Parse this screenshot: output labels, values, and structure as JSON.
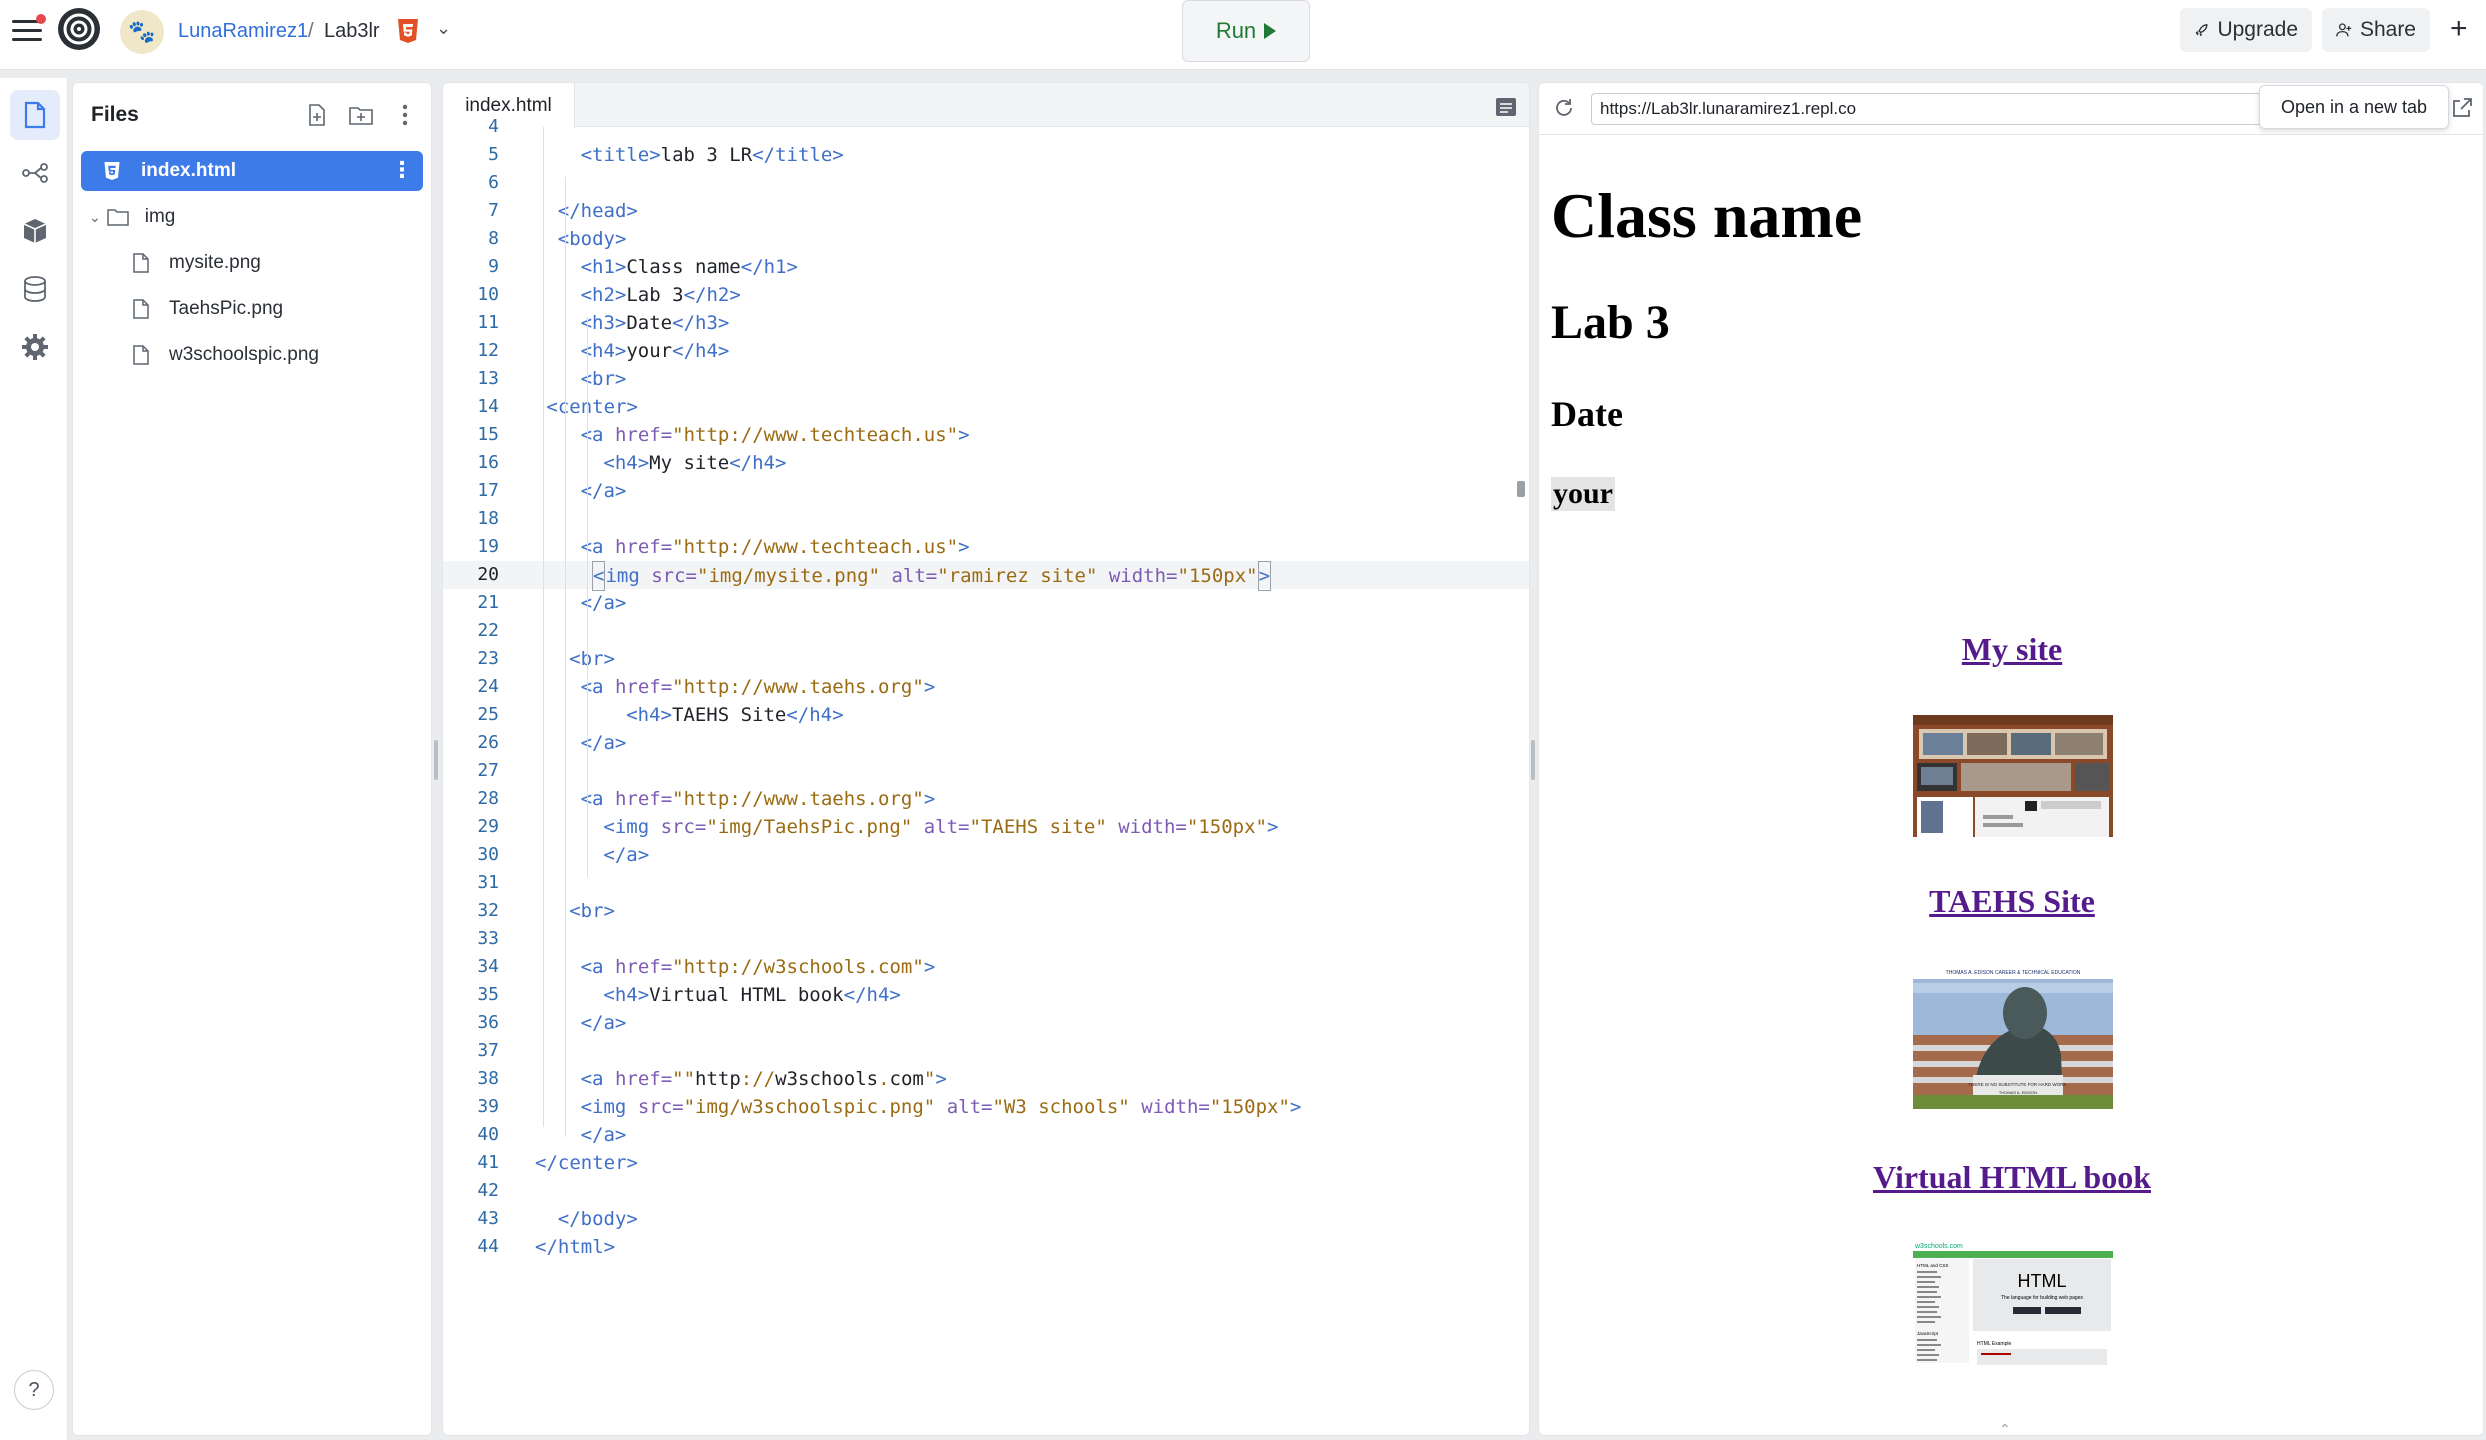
{
  "topbar": {
    "username": "LunaRamirez1",
    "separator": "/",
    "repl_name": "Lab3lr",
    "run_label": "Run",
    "upgrade_label": "Upgrade",
    "share_label": "Share",
    "new_tab_symbol": "+"
  },
  "rail": {
    "items": [
      "files-icon",
      "git-icon",
      "packages-icon",
      "database-icon",
      "settings-icon"
    ],
    "help_label": "?"
  },
  "files": {
    "title": "Files",
    "items": [
      {
        "name": "index.html",
        "type": "html",
        "selected": true
      },
      {
        "name": "img",
        "type": "folder"
      },
      {
        "name": "mysite.png",
        "type": "file"
      },
      {
        "name": "TaehsPic.png",
        "type": "file"
      },
      {
        "name": "w3schoolspic.png",
        "type": "file"
      }
    ]
  },
  "editor": {
    "tab_label": "index.html",
    "active_line": 20,
    "lines": [
      {
        "n": 4,
        "indent": 2,
        "html": ""
      },
      {
        "n": 5,
        "indent": 2,
        "html": "<span class='tg'>&lt;title&gt;</span><span class='tx'>lab 3 LR</span><span class='tg'>&lt;/title&gt;</span>"
      },
      {
        "n": 6,
        "indent": 0,
        "html": ""
      },
      {
        "n": 7,
        "indent": 1,
        "html": "<span class='tg'>&lt;/head&gt;</span>"
      },
      {
        "n": 8,
        "indent": 1,
        "html": "<span class='tg'>&lt;body&gt;</span>"
      },
      {
        "n": 9,
        "indent": 2,
        "html": "<span class='tg'>&lt;h1&gt;</span><span class='tx'>Class name</span><span class='tg'>&lt;/h1&gt;</span>"
      },
      {
        "n": 10,
        "indent": 2,
        "html": "<span class='tg'>&lt;h2&gt;</span><span class='tx'>Lab 3</span><span class='tg'>&lt;/h2&gt;</span>"
      },
      {
        "n": 11,
        "indent": 2,
        "html": "<span class='tg'>&lt;h3&gt;</span><span class='tx'>Date</span><span class='tg'>&lt;/h3&gt;</span>"
      },
      {
        "n": 12,
        "indent": 2,
        "html": "<span class='tg'>&lt;h4&gt;</span><span class='tx'>your</span><span class='tg'>&lt;/h4&gt;</span>"
      },
      {
        "n": 13,
        "indent": 2,
        "html": "<span class='tg'>&lt;br&gt;</span>"
      },
      {
        "n": 14,
        "indent": 0.5,
        "html": "<span class='tg'>&lt;center&gt;</span>"
      },
      {
        "n": 15,
        "indent": 2,
        "html": "<span class='tg'>&lt;a</span> <span class='at'>href=</span><span class='st'>\"http://www.techteach.us\"</span><span class='tg'>&gt;</span>"
      },
      {
        "n": 16,
        "indent": 3,
        "html": "<span class='tg'>&lt;h4&gt;</span><span class='tx'>My site</span><span class='tg'>&lt;/h4&gt;</span>"
      },
      {
        "n": 17,
        "indent": 2,
        "html": "<span class='tg'>&lt;/a&gt;</span>"
      },
      {
        "n": 18,
        "indent": 0,
        "html": ""
      },
      {
        "n": 19,
        "indent": 2,
        "html": "<span class='tg'>&lt;a</span> <span class='at'>href=</span><span class='st'>\"http://www.techteach.us\"</span><span class='tg'>&gt;</span>"
      },
      {
        "n": 20,
        "indent": 2.5,
        "html": "<span class='cursor-box'><span class='tg'>&lt;</span></span><span class='tg'>img</span> <span class='at'>src=</span><span class='st'>\"img/mysite.png\"</span> <span class='at'>alt=</span><span class='st'>\"ramirez site\"</span> <span class='at'>width=</span><span class='st'>\"150px\"</span><span class='cursor-box'><span class='tg'>&gt;</span></span>"
      },
      {
        "n": 21,
        "indent": 2,
        "html": "<span class='tg'>&lt;/a&gt;</span>"
      },
      {
        "n": 22,
        "indent": 0,
        "html": ""
      },
      {
        "n": 23,
        "indent": 1.5,
        "html": "<span class='tg'>&lt;br&gt;</span>"
      },
      {
        "n": 24,
        "indent": 2,
        "html": "<span class='tg'>&lt;a</span> <span class='at'>href=</span><span class='st'>\"http://www.taehs.org\"</span><span class='tg'>&gt;</span>"
      },
      {
        "n": 25,
        "indent": 4,
        "html": "<span class='tg'>&lt;h4&gt;</span><span class='tx'>TAEHS Site</span><span class='tg'>&lt;/h4&gt;</span>"
      },
      {
        "n": 26,
        "indent": 2,
        "html": "<span class='tg'>&lt;/a&gt;</span>"
      },
      {
        "n": 27,
        "indent": 0,
        "html": ""
      },
      {
        "n": 28,
        "indent": 2,
        "html": "<span class='tg'>&lt;a</span> <span class='at'>href=</span><span class='st'>\"http://www.taehs.org\"</span><span class='tg'>&gt;</span>"
      },
      {
        "n": 29,
        "indent": 3,
        "html": "<span class='tg'>&lt;img</span> <span class='at'>src=</span><span class='st'>\"img/TaehsPic.png\"</span> <span class='at'>alt=</span><span class='st'>\"TAEHS site\"</span> <span class='at'>width=</span><span class='st'>\"150px\"</span><span class='tg'>&gt;</span>"
      },
      {
        "n": 30,
        "indent": 3,
        "html": "<span class='tg'>&lt;/a&gt;</span>"
      },
      {
        "n": 31,
        "indent": 0,
        "html": ""
      },
      {
        "n": 32,
        "indent": 1.5,
        "html": "<span class='tg'>&lt;br&gt;</span>"
      },
      {
        "n": 33,
        "indent": 0,
        "html": ""
      },
      {
        "n": 34,
        "indent": 2,
        "html": "<span class='tg'>&lt;a</span> <span class='at'>href=</span><span class='st'>\"http://w3schools.com\"</span><span class='tg'>&gt;</span>"
      },
      {
        "n": 35,
        "indent": 3,
        "html": "<span class='tg'>&lt;h4&gt;</span><span class='tx'>Virtual HTML book</span><span class='tg'>&lt;/h4&gt;</span>"
      },
      {
        "n": 36,
        "indent": 2,
        "html": "<span class='tg'>&lt;/a&gt;</span>"
      },
      {
        "n": 37,
        "indent": 0,
        "html": ""
      },
      {
        "n": 38,
        "indent": 2,
        "html": "<span class='tg'>&lt;a</span> <span class='at'>href=</span><span class='st'>\"\"</span><span class='tx'>http</span><span class='st'>://</span><span class='tx'>w3schools</span><span class='st'>.</span><span class='tx'>com</span><span class='st'>\"</span><span class='tg'>&gt;</span>"
      },
      {
        "n": 39,
        "indent": 2,
        "html": "<span class='tg'>&lt;img</span> <span class='at'>src=</span><span class='st'>\"img/w3schoolspic.png\"</span> <span class='at'>alt=</span><span class='st'>\"W3 schools\"</span> <span class='at'>width=</span><span class='st'>\"150px\"</span><span class='tg'>&gt;</span>"
      },
      {
        "n": 40,
        "indent": 2,
        "html": "<span class='tg'>&lt;/a&gt;</span>"
      },
      {
        "n": 41,
        "indent": 0,
        "html": "<span class='tg'>&lt;/center&gt;</span>"
      },
      {
        "n": 42,
        "indent": 0,
        "html": ""
      },
      {
        "n": 43,
        "indent": 1,
        "html": "<span class='tg'>&lt;/body&gt;</span>"
      },
      {
        "n": 44,
        "indent": 0,
        "html": "<span class='tg'>&lt;/html&gt;</span>"
      }
    ]
  },
  "preview": {
    "url": "https://Lab3lr.lunaramirez1.repl.co",
    "tooltip": "Open in a new tab",
    "h1": "Class name",
    "h2": "Lab 3",
    "h3": "Date",
    "h4": "your",
    "link1": "My site",
    "link2": "TAEHS Site",
    "link3": "Virtual HTML book",
    "w3_brand": "w3schools.com",
    "w3_heading": "HTML",
    "w3_tagline": "The language for building web pages",
    "w3_sidebar_title": "HTML and CSS",
    "w3_section": "JavaScript",
    "w3_example": "HTML Example",
    "taehs_banner": "THOMAS A. EDISON CAREER & TECHNICAL EDUCATION",
    "taehs_quote": "THERE IS NO SUBSTITUTE FOR HARD WORK.",
    "taehs_author": "THOMAS A. EDISON"
  },
  "colors": {
    "accent": "#3d7be8",
    "run_green": "#1e7a34",
    "visited_link": "#551a8b",
    "tag": "#3f6fc7",
    "attr": "#7d5bb3",
    "string": "#9a6b12"
  }
}
